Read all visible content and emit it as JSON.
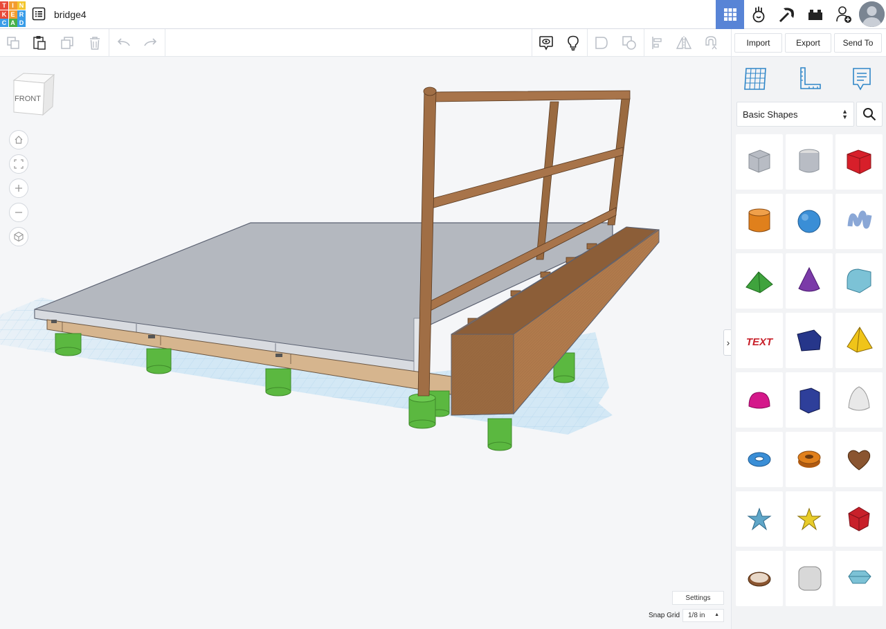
{
  "app": {
    "logo_letters": [
      "T",
      "I",
      "N",
      "K",
      "E",
      "R",
      "C",
      "A",
      "D"
    ],
    "logo_colors": [
      "#e84a3a",
      "#f39c2f",
      "#f3c62f",
      "#e84a3a",
      "#f39c2f",
      "#3a9de8",
      "#3a9de8",
      "#47b04b",
      "#3a9de8"
    ],
    "project_name": "bridge4"
  },
  "topbar": {
    "buttons": [
      "3d-design-view",
      "circuits-view",
      "minecraft-view",
      "bricks-view",
      "invite-user"
    ],
    "active": "3d-design-view",
    "accent": "#5884d6"
  },
  "toolbar": {
    "left_tools": [
      "copy",
      "paste",
      "duplicate",
      "delete",
      "undo",
      "redo"
    ],
    "right_tools": [
      "show-all",
      "notes",
      "group",
      "ungroup",
      "align",
      "mirror",
      "magnet"
    ]
  },
  "header_actions": {
    "import_label": "Import",
    "export_label": "Export",
    "send_to_label": "Send To"
  },
  "viewport": {
    "view_cube_label": "FRONT",
    "nav": [
      "home-view",
      "fit-view",
      "zoom-in",
      "zoom-out",
      "perspective"
    ],
    "settings_label": "Settings",
    "snap_grid_label": "Snap Grid",
    "snap_grid_value": "1/8 in"
  },
  "panel": {
    "tabs": [
      "workplane",
      "ruler",
      "notes"
    ],
    "category": "Basic Shapes",
    "shapes": [
      {
        "name": "box-hole",
        "color": "#b8bcc4"
      },
      {
        "name": "cylinder-hole",
        "color": "#b8bcc4"
      },
      {
        "name": "box",
        "color": "#d71f2a"
      },
      {
        "name": "cylinder",
        "color": "#e0801c"
      },
      {
        "name": "sphere",
        "color": "#3a8ed6"
      },
      {
        "name": "scribble",
        "color": "#8aa7d6"
      },
      {
        "name": "roof",
        "color": "#3fa33d"
      },
      {
        "name": "cone",
        "color": "#7b3aa8"
      },
      {
        "name": "round-roof",
        "color": "#7cc2d6"
      },
      {
        "name": "text",
        "color": "#c8202a"
      },
      {
        "name": "wedge",
        "color": "#26368a"
      },
      {
        "name": "pyramid",
        "color": "#f0c419"
      },
      {
        "name": "half-sphere",
        "color": "#d4188a"
      },
      {
        "name": "polygon",
        "color": "#2e3f9a"
      },
      {
        "name": "paraboloid",
        "color": "#e8e8e8"
      },
      {
        "name": "torus",
        "color": "#3a8ed6"
      },
      {
        "name": "tube",
        "color": "#e0801c"
      },
      {
        "name": "heart",
        "color": "#8a5530"
      },
      {
        "name": "star",
        "color": "#5fa6c8"
      },
      {
        "name": "star-gold",
        "color": "#e8cc2a"
      },
      {
        "name": "icosahedron",
        "color": "#c8202a"
      },
      {
        "name": "ring",
        "color": "#8a5530"
      },
      {
        "name": "rounded-box",
        "color": "#d8d8d8"
      },
      {
        "name": "diamond",
        "color": "#7cc2d6"
      }
    ]
  }
}
